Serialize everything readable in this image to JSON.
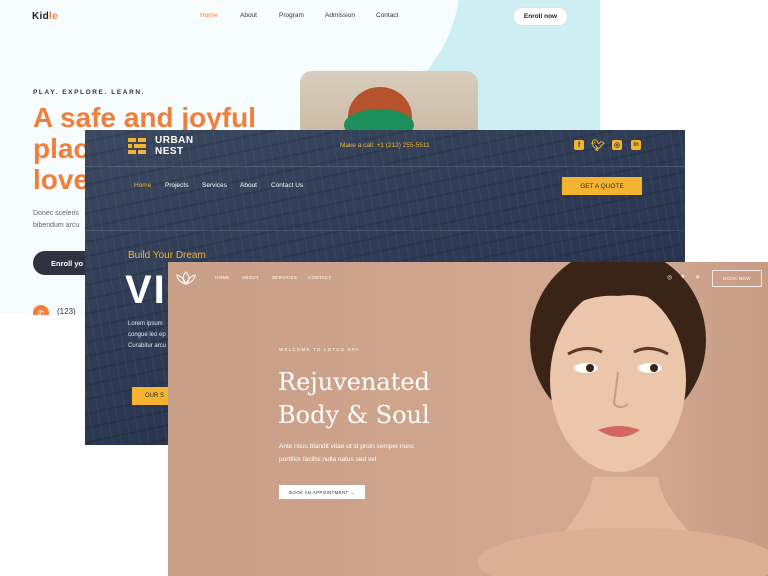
{
  "kidle": {
    "logo_main": "Kid",
    "logo_accent": "le",
    "nav": [
      "Home",
      "About",
      "Program",
      "Admission",
      "Contact"
    ],
    "enroll_button": "Enroll now",
    "eyebrow": "PLAY. EXPLORE. LEARN.",
    "headline_line1": "A safe and joyful",
    "headline_line2": "plac",
    "headline_line3": "love",
    "body_line1": "Donec sceleris",
    "body_line2": "bibendum arcu",
    "cta_button": "Enroll yo",
    "phone_icon": "phone-icon",
    "phone": "(123)",
    "colors": {
      "accent": "#f07f3c",
      "dark": "#2d3340"
    }
  },
  "urban": {
    "logo_line1": "URBAN",
    "logo_line2": "NEST",
    "call": "Make a call: +1 (212) 255-5511",
    "social": [
      "facebook-icon",
      "twitter-icon",
      "instagram-icon",
      "linkedin-icon"
    ],
    "nav": [
      "Home",
      "Projects",
      "Services",
      "About",
      "Contact Us"
    ],
    "quote_button": "GET A QUOTE",
    "subtitle": "Build Your Dream",
    "big_text": "VI",
    "body_line1": "Lorem ipsum",
    "body_line2": "congue leo ep",
    "body_line3": "Curabitur arcu",
    "cta_button": "OUR S",
    "colors": {
      "accent": "#f5b430",
      "bg": "#2d3b52"
    }
  },
  "lotus": {
    "logo_icon": "lotus-icon",
    "nav": [
      "HOME",
      "ABOUT",
      "SERVICES",
      "CONTACT"
    ],
    "social": [
      "instagram-icon",
      "facebook-icon",
      "twitter-icon"
    ],
    "book_button": "BOOK NOW",
    "eyebrow": "WELCOME TO LOTUS SPA",
    "headline_line1": "Rejuvenated",
    "headline_line2": "Body & Soul",
    "body_line1": "Ante risus blandit vitae ut id proin semper nunc",
    "body_line2": "porttitor facilisi nulla natus sed vel",
    "cta_button": "BOOK AN APPOINTMENT →",
    "colors": {
      "bg": "#cfa58c",
      "skin": "#e9c2a6",
      "hair": "#3a2418",
      "lips": "#d2675f"
    }
  }
}
